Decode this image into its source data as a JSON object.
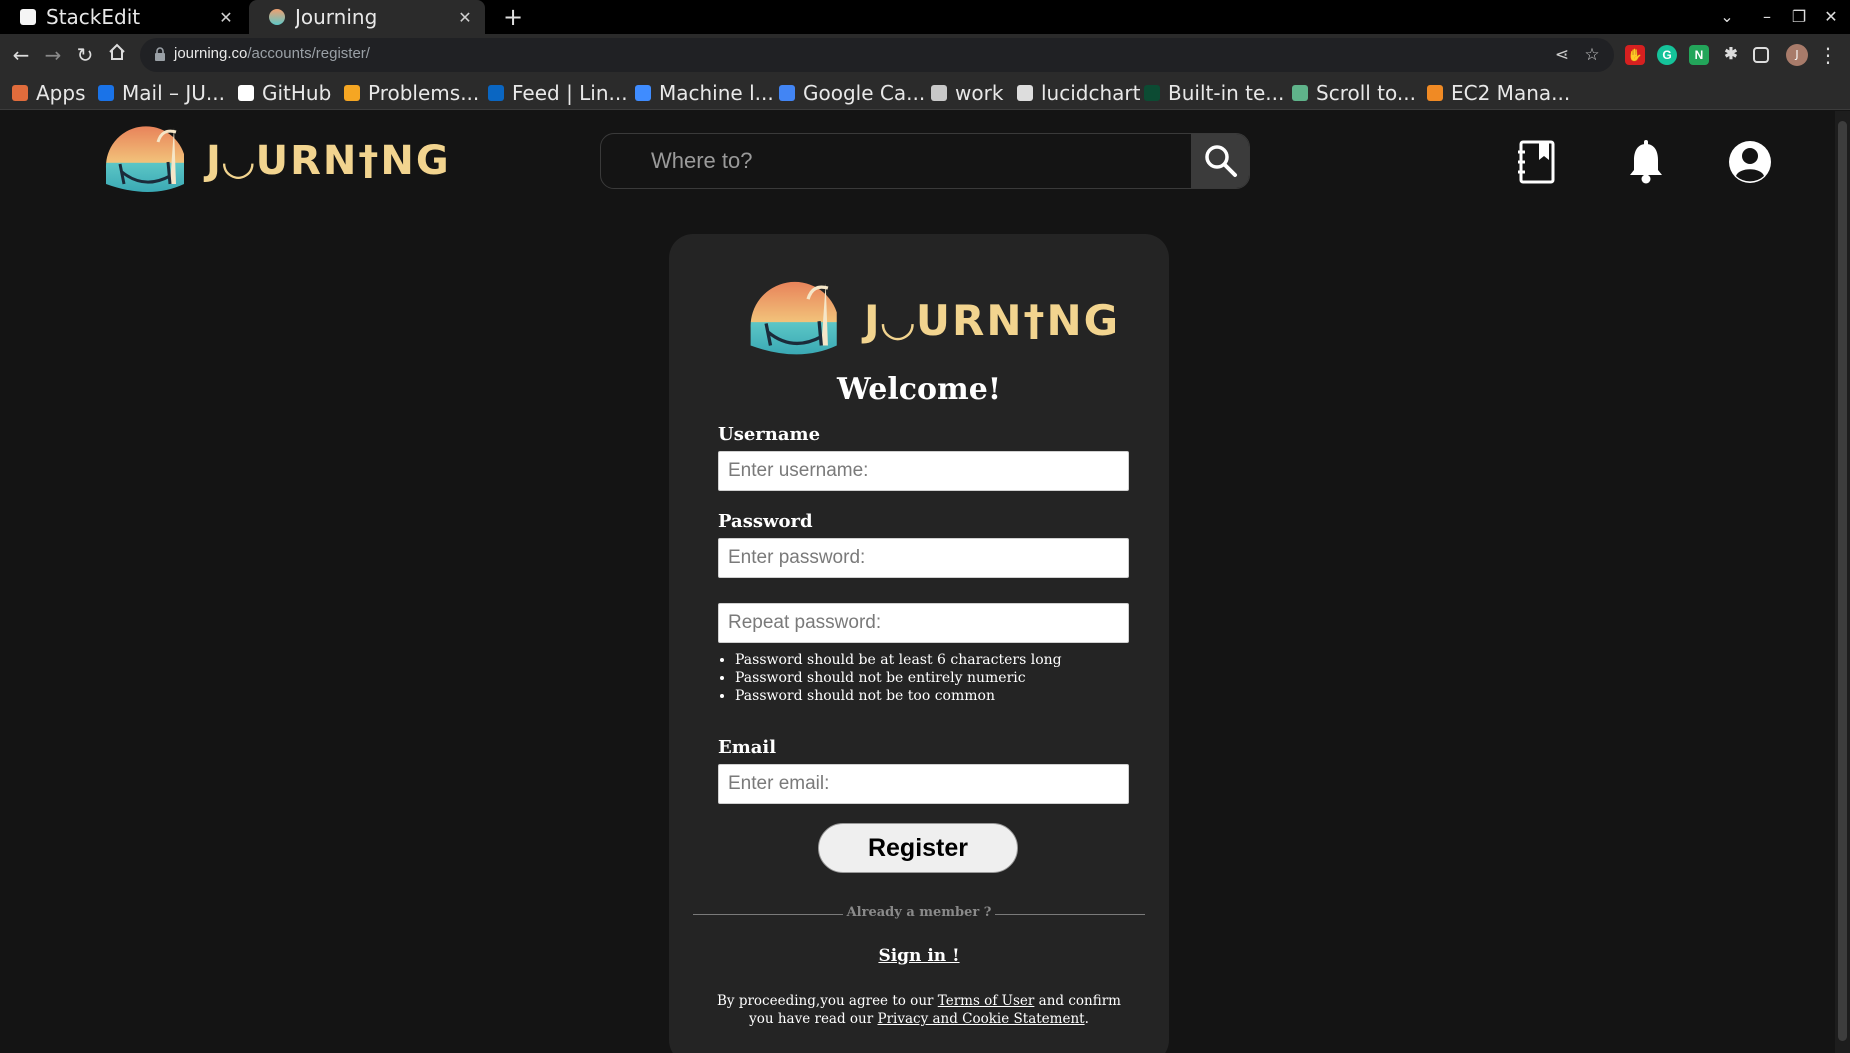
{
  "browser": {
    "tabs": [
      {
        "title": "StackEdit",
        "active": false
      },
      {
        "title": "Journing",
        "active": true
      }
    ],
    "url_host": "journing.co",
    "url_path": "/accounts/register/",
    "profile_initial": "J",
    "bookmarks": [
      {
        "label": "Apps",
        "icon": "apps-grid-icon",
        "color": "#e06c3c"
      },
      {
        "label": "Mail – JU...",
        "icon": "outlook-icon",
        "color": "#1a73e8"
      },
      {
        "label": "GitHub",
        "icon": "github-icon",
        "color": "#ffffff"
      },
      {
        "label": "Problems...",
        "icon": "leetcode-icon",
        "color": "#f5a623"
      },
      {
        "label": "Feed | Lin...",
        "icon": "linkedin-icon",
        "color": "#0a66c2"
      },
      {
        "label": "Machine l...",
        "icon": "arrow-favicon-icon",
        "color": "#3f8cff"
      },
      {
        "label": "Google Ca...",
        "icon": "google-calendar-icon",
        "color": "#4285f4"
      },
      {
        "label": "work",
        "icon": "folder-icon",
        "color": "#c8c8c8"
      },
      {
        "label": "lucidchart",
        "icon": "lucidchart-icon",
        "color": "#dddddd"
      },
      {
        "label": "Built-in te...",
        "icon": "django-icon",
        "color": "#0c4b33"
      },
      {
        "label": "Scroll to...",
        "icon": "scroll-favicon-icon",
        "color": "#5fb38a"
      },
      {
        "label": "EC2 Mana...",
        "icon": "aws-icon",
        "color": "#f08a24"
      }
    ]
  },
  "header": {
    "brand": "J◡URN†NG",
    "search_placeholder": "Where to?"
  },
  "card": {
    "brand": "J◡URN†NG",
    "welcome": "Welcome!",
    "username_label": "Username",
    "username_placeholder": "Enter username:",
    "password_label": "Password",
    "password_placeholder": "Enter password:",
    "repeat_placeholder": "Repeat password:",
    "rules": [
      "Password should be at least 6 characters long",
      "Password should not be entirely numeric",
      "Password should not be too common"
    ],
    "email_label": "Email",
    "email_placeholder": "Enter email:",
    "register_label": "Register",
    "divider_text": "Already a member ?",
    "signin_label": "Sign in !",
    "legal_pre": "By proceeding,you agree to our ",
    "terms_link": "Terms of User",
    "legal_mid": " and confirm you have read our ",
    "privacy_link": "Privacy and Cookie Statement",
    "legal_post": "."
  },
  "colors": {
    "page_bg": "#141414",
    "card_bg": "#242424",
    "brand_gold": "#f2d48f"
  }
}
